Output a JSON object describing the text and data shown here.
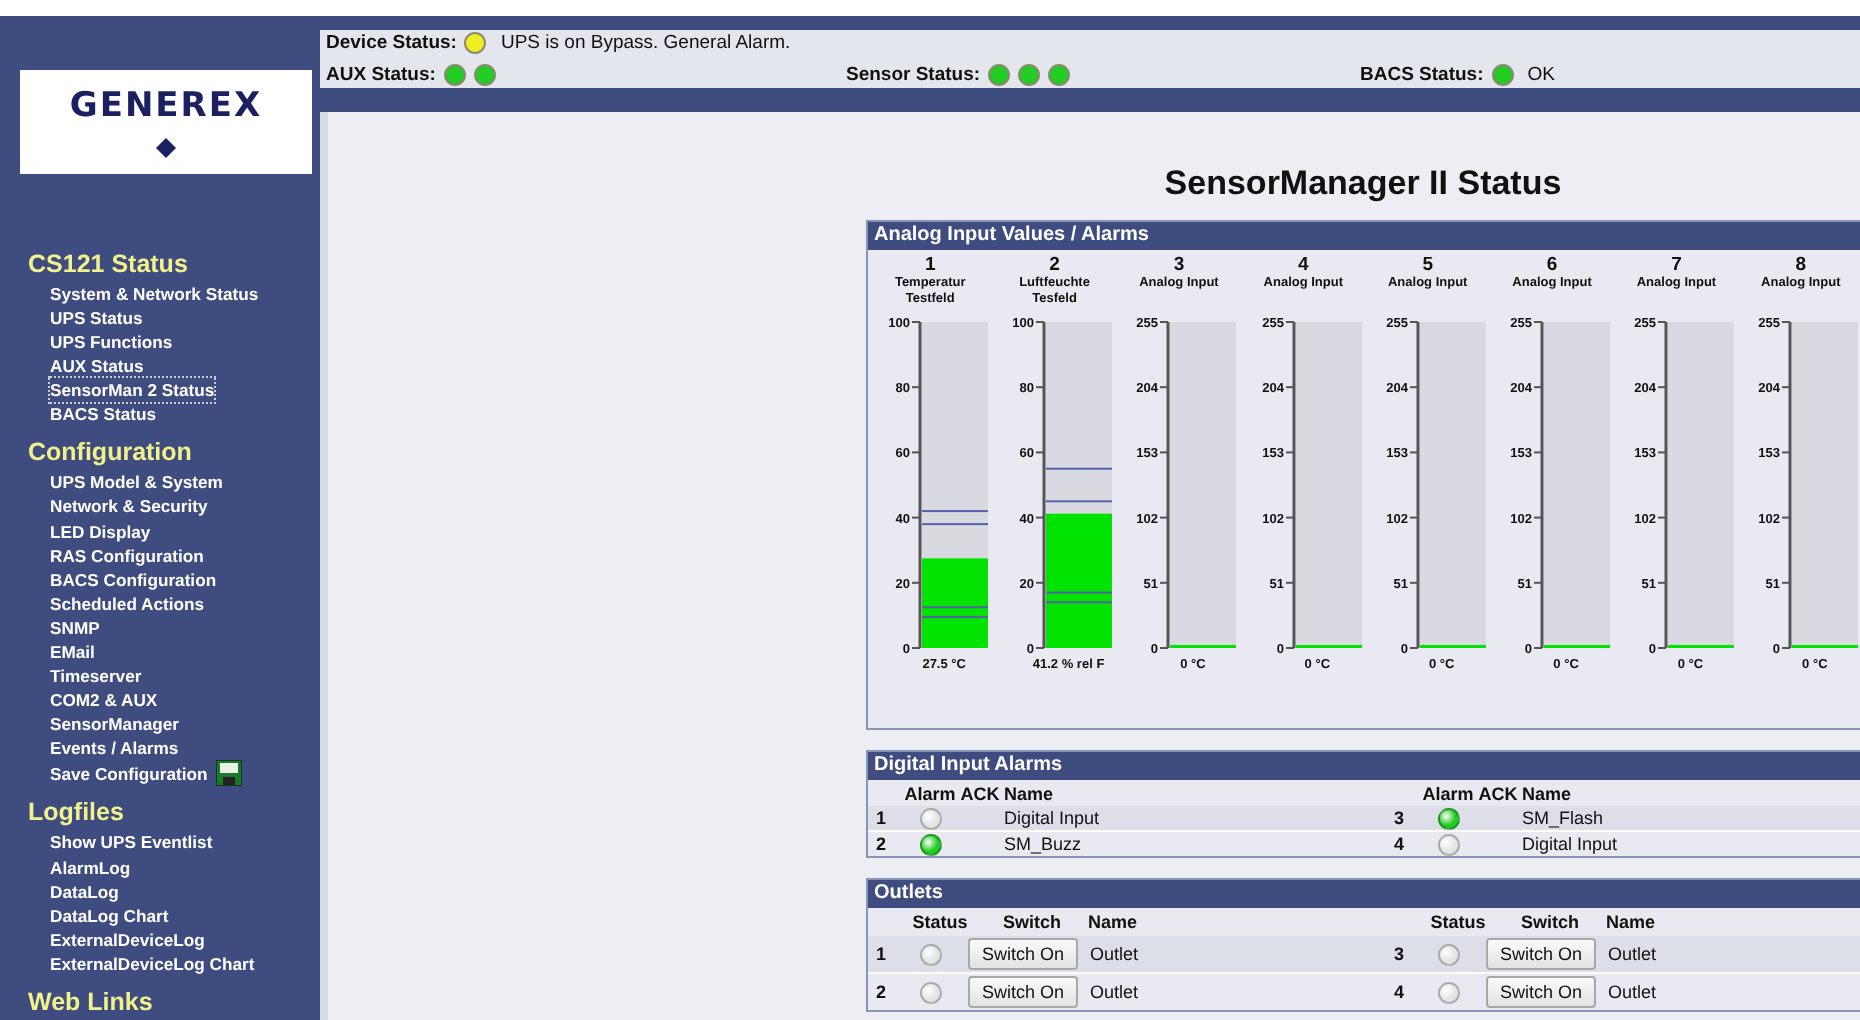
{
  "logo": {
    "text": "GENEREX"
  },
  "status": {
    "device": {
      "label": "Device Status:",
      "leds": [
        {
          "color": "#eeee22"
        }
      ],
      "text": "UPS is on Bypass. General Alarm."
    },
    "aux": {
      "label": "AUX Status:",
      "leds": [
        {
          "color": "#22cc22"
        },
        {
          "color": "#22cc22"
        }
      ]
    },
    "sensor": {
      "label": "Sensor Status:",
      "leds": [
        {
          "color": "#22cc22"
        },
        {
          "color": "#22cc22"
        },
        {
          "color": "#22cc22"
        }
      ]
    },
    "bacs": {
      "label": "BACS Status:",
      "leds": [
        {
          "color": "#22cc22"
        }
      ],
      "text": "OK"
    }
  },
  "sidebar": [
    {
      "title": "CS121 Status",
      "items": [
        {
          "label": "System & Network Status",
          "selected": false
        },
        {
          "label": "UPS Status",
          "selected": false
        },
        {
          "label": "UPS Functions",
          "selected": false
        },
        {
          "label": "AUX Status",
          "selected": false
        },
        {
          "label": "SensorMan 2 Status",
          "selected": true
        },
        {
          "label": "BACS Status",
          "selected": false
        }
      ]
    },
    {
      "title": "Configuration",
      "items": [
        {
          "label": "UPS Model & System",
          "selected": false
        },
        {
          "label": "Network & Security",
          "selected": false
        },
        {
          "label": "LED Display",
          "selected": false
        },
        {
          "label": "RAS Configuration",
          "selected": false
        },
        {
          "label": "BACS Configuration",
          "selected": false
        },
        {
          "label": "Scheduled Actions",
          "selected": false
        },
        {
          "label": "SNMP",
          "selected": false
        },
        {
          "label": "EMail",
          "selected": false
        },
        {
          "label": "Timeserver",
          "selected": false
        },
        {
          "label": "COM2 & AUX",
          "selected": false
        },
        {
          "label": "SensorManager",
          "selected": false
        },
        {
          "label": "Events / Alarms",
          "selected": false
        },
        {
          "label": "Save Configuration",
          "selected": false,
          "kind": "save"
        }
      ]
    },
    {
      "title": "Logfiles",
      "items": [
        {
          "label": "Show UPS Eventlist",
          "selected": false
        },
        {
          "label": "AlarmLog",
          "selected": false
        },
        {
          "label": "DataLog",
          "selected": false
        },
        {
          "label": "DataLog Chart",
          "selected": false
        },
        {
          "label": "ExternalDeviceLog",
          "selected": false
        },
        {
          "label": "ExternalDeviceLog Chart",
          "selected": false
        }
      ]
    },
    {
      "title": "Web Links"
    }
  ],
  "title": "SensorManager II Status",
  "analog": {
    "title": "Analog Input Values / Alarms",
    "inputs": [
      {
        "number": "1",
        "name": "Temperatur Testfeld",
        "reading": "27.5 °C",
        "chart_data": {
          "type": "bar",
          "values": [
            27.5
          ],
          "ylim": [
            0,
            100
          ],
          "yticks": [
            0,
            20,
            40,
            60,
            80,
            100
          ]
        },
        "limits": [
          {
            "level": 0.42
          },
          {
            "level": 0.38
          },
          {
            "level": 0.125
          },
          {
            "level": 0.095
          }
        ]
      },
      {
        "number": "2",
        "name": "Luftfeuchte Tesfeld",
        "reading": "41.2 % rel F",
        "chart_data": {
          "type": "bar",
          "values": [
            41.2
          ],
          "ylim": [
            0,
            100
          ],
          "yticks": [
            0,
            20,
            40,
            60,
            80,
            100
          ]
        },
        "limits": [
          {
            "level": 0.55
          },
          {
            "level": 0.45
          },
          {
            "level": 0.17
          },
          {
            "level": 0.14
          }
        ]
      },
      {
        "number": "3",
        "name": "Analog Input",
        "reading": "0 °C",
        "chart_data": {
          "type": "bar",
          "values": [
            0
          ],
          "ylim": [
            0,
            255
          ],
          "yticks": [
            0,
            51,
            102,
            153,
            204,
            255
          ]
        }
      },
      {
        "number": "4",
        "name": "Analog Input",
        "reading": "0 °C",
        "chart_data": {
          "type": "bar",
          "values": [
            0
          ],
          "ylim": [
            0,
            255
          ],
          "yticks": [
            0,
            51,
            102,
            153,
            204,
            255
          ]
        }
      },
      {
        "number": "5",
        "name": "Analog Input",
        "reading": "0 °C",
        "chart_data": {
          "type": "bar",
          "values": [
            0
          ],
          "ylim": [
            0,
            255
          ],
          "yticks": [
            0,
            51,
            102,
            153,
            204,
            255
          ]
        }
      },
      {
        "number": "6",
        "name": "Analog Input",
        "reading": "0 °C",
        "chart_data": {
          "type": "bar",
          "values": [
            0
          ],
          "ylim": [
            0,
            255
          ],
          "yticks": [
            0,
            51,
            102,
            153,
            204,
            255
          ]
        }
      },
      {
        "number": "7",
        "name": "Analog Input",
        "reading": "0 °C",
        "chart_data": {
          "type": "bar",
          "values": [
            0
          ],
          "ylim": [
            0,
            255
          ],
          "yticks": [
            0,
            51,
            102,
            153,
            204,
            255
          ]
        }
      },
      {
        "number": "8",
        "name": "Analog Input",
        "reading": "0 °C",
        "chart_data": {
          "type": "bar",
          "values": [
            0
          ],
          "ylim": [
            0,
            255
          ],
          "yticks": [
            0,
            51,
            102,
            153,
            204,
            255
          ]
        }
      }
    ]
  },
  "digital": {
    "title": "Digital Input Alarms",
    "halves": [
      {
        "columns": [
          "Alarm",
          "ACK",
          "Name"
        ],
        "rows": [
          {
            "number": "1",
            "alarm": false,
            "name": "Digital Input"
          },
          {
            "number": "2",
            "alarm": true,
            "name": "SM_Buzz"
          }
        ]
      },
      {
        "columns": [
          "Alarm",
          "ACK",
          "Name"
        ],
        "rows": [
          {
            "number": "3",
            "alarm": true,
            "name": "SM_Flash"
          },
          {
            "number": "4",
            "alarm": false,
            "name": "Digital Input"
          }
        ]
      }
    ]
  },
  "outlets": {
    "title": "Outlets",
    "halves": [
      {
        "columns": [
          "Status",
          "Switch",
          "Name"
        ],
        "rows": [
          {
            "number": "1",
            "on": false,
            "button": "Switch On",
            "name": "Outlet"
          },
          {
            "number": "2",
            "on": false,
            "button": "Switch On",
            "name": "Outlet"
          }
        ]
      },
      {
        "columns": [
          "Status",
          "Switch",
          "Name"
        ],
        "rows": [
          {
            "number": "3",
            "on": false,
            "button": "Switch On",
            "name": "Outlet"
          },
          {
            "number": "4",
            "on": false,
            "button": "Switch On",
            "name": "Outlet"
          }
        ]
      }
    ]
  }
}
